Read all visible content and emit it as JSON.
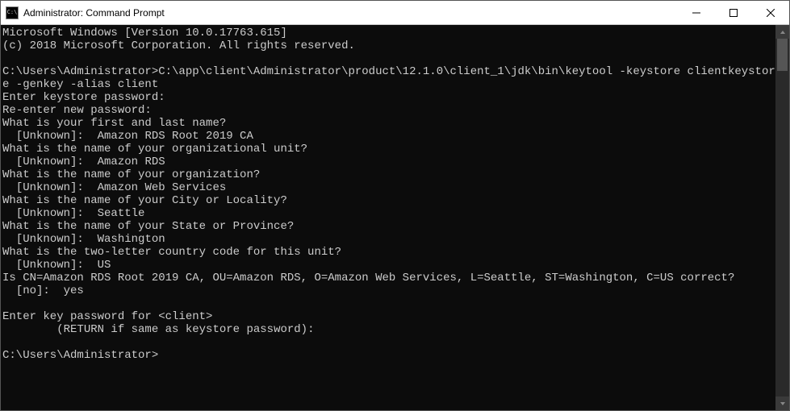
{
  "window": {
    "title": "Administrator: Command Prompt",
    "icon_label": "C:\\"
  },
  "terminal": {
    "lines": [
      "Microsoft Windows [Version 10.0.17763.615]",
      "(c) 2018 Microsoft Corporation. All rights reserved.",
      "",
      "C:\\Users\\Administrator>C:\\app\\client\\Administrator\\product\\12.1.0\\client_1\\jdk\\bin\\keytool -keystore clientkeystore -genkey -alias client",
      "Enter keystore password:",
      "Re-enter new password:",
      "What is your first and last name?",
      "  [Unknown]:  Amazon RDS Root 2019 CA",
      "What is the name of your organizational unit?",
      "  [Unknown]:  Amazon RDS",
      "What is the name of your organization?",
      "  [Unknown]:  Amazon Web Services",
      "What is the name of your City or Locality?",
      "  [Unknown]:  Seattle",
      "What is the name of your State or Province?",
      "  [Unknown]:  Washington",
      "What is the two-letter country code for this unit?",
      "  [Unknown]:  US",
      "Is CN=Amazon RDS Root 2019 CA, OU=Amazon RDS, O=Amazon Web Services, L=Seattle, ST=Washington, C=US correct?",
      "  [no]:  yes",
      "",
      "Enter key password for <client>",
      "        (RETURN if same as keystore password):",
      "",
      "C:\\Users\\Administrator>"
    ]
  }
}
